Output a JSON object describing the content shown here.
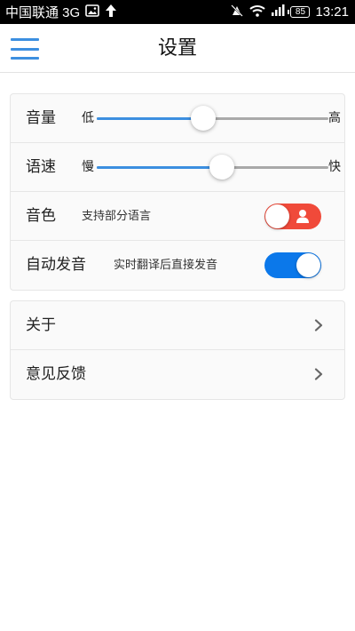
{
  "status_bar": {
    "carrier": "中国联通 3G",
    "battery": "85",
    "time": "13:21"
  },
  "header": {
    "title": "设置",
    "menu_icon": "hamburger-menu-icon"
  },
  "settings": {
    "volume": {
      "label": "音量",
      "min_label": "低",
      "max_label": "高",
      "value": 0.46
    },
    "speed": {
      "label": "语速",
      "min_label": "慢",
      "max_label": "快",
      "value": 0.54
    },
    "timbre": {
      "label": "音色",
      "description": "支持部分语言",
      "toggle_icon": "person-icon"
    },
    "auto_pronounce": {
      "label": "自动发音",
      "description": "实时翻译后直接发音",
      "enabled": true
    }
  },
  "links": {
    "about": {
      "label": "关于"
    },
    "feedback": {
      "label": "意见反馈"
    }
  },
  "colors": {
    "accent": "#3c8fe0",
    "toggle_on": "#0b78ea",
    "toggle_voice": "#f04a3a"
  }
}
